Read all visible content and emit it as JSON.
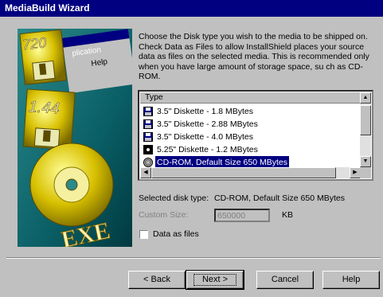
{
  "window": {
    "title": "MediaBuild Wizard"
  },
  "illustration": {
    "disk1_label": "720",
    "disk2_label": "1.44",
    "menu_text": "plication",
    "menu_item": "Help",
    "exe_label": "EXE"
  },
  "instructions": "Choose the Disk type you wish to the media to be shipped on. Check Data as Files to allow InstallShield places your source data as files on the selected media.  This is recommended only when you have large amount of storage space, su ch as CD-ROM.",
  "disk_list": {
    "header": "Type",
    "items": [
      {
        "label": "3.5\" Diskette - 1.8 MBytes",
        "icon": "floppy-disk-icon",
        "selected": false
      },
      {
        "label": "3.5\" Diskette - 2.88 MBytes",
        "icon": "floppy-disk-icon",
        "selected": false
      },
      {
        "label": "3.5\" Diskette - 4.0 MBytes",
        "icon": "floppy-disk-icon",
        "selected": false
      },
      {
        "label": "5.25\" Diskette - 1.2 MBytes",
        "icon": "floppy-525-icon",
        "selected": false
      },
      {
        "label": "CD-ROM, Default Size 650 MBytes",
        "icon": "cd-rom-icon",
        "selected": true
      }
    ]
  },
  "selected_disk_type": {
    "label": "Selected disk type:",
    "value": "CD-ROM, Default Size 650 MBytes"
  },
  "custom_size": {
    "label": "Custom Size:",
    "value": "650000",
    "unit": "KB"
  },
  "data_as_files": {
    "label": "Data as files",
    "checked": false
  },
  "buttons": {
    "back": "< Back",
    "next": "Next >",
    "cancel": "Cancel",
    "help": "Help"
  },
  "colors": {
    "titlebar": "#000080",
    "selection": "#000080",
    "face": "#c0c0c0",
    "illustration_bg": "#006666"
  }
}
